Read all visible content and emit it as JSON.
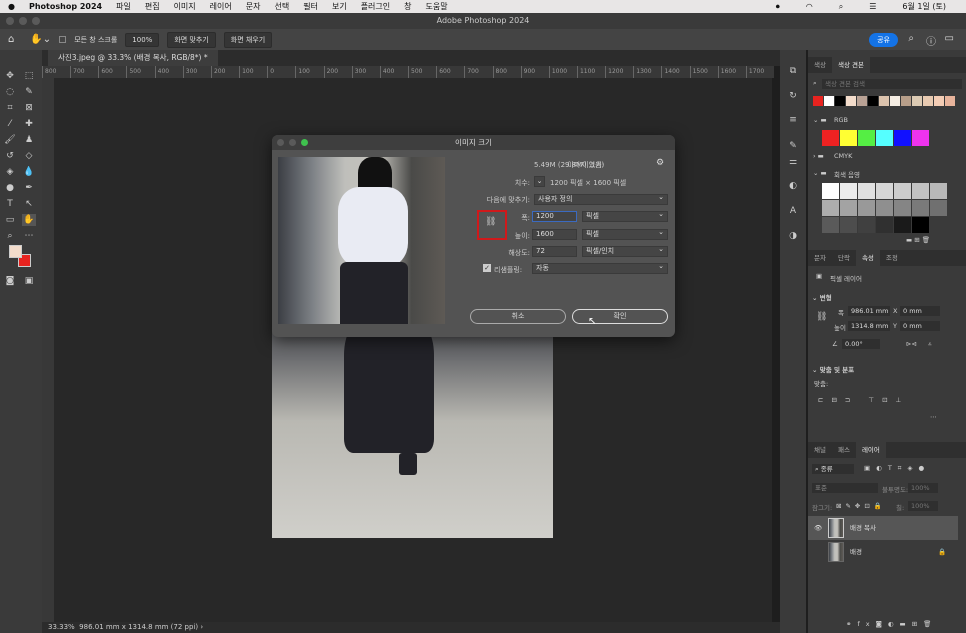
{
  "menubar": {
    "app": "Photoshop 2024",
    "items": [
      "파일",
      "편집",
      "이미지",
      "레이어",
      "문자",
      "선택",
      "필터",
      "보기",
      "플러그인",
      "창",
      "도움말"
    ],
    "date": "6월 1일 (토)"
  },
  "window": {
    "title": "Adobe Photoshop 2024"
  },
  "options": {
    "scroll_all": "모든 창 스크롤",
    "zoom": "100%",
    "fit_screen": "화면 맞추기",
    "fill_screen": "화면 채우기",
    "share": "공유"
  },
  "document": {
    "tab": "사진3.jpeg @ 33.3% (배경 복사, RGB/8*) *",
    "zoom": "33.33%",
    "info": "986.01 mm x 1314.8 mm (72 ppi)"
  },
  "ruler": [
    "800",
    "700",
    "600",
    "500",
    "400",
    "300",
    "200",
    "100",
    "0",
    "100",
    "200",
    "300",
    "400",
    "500",
    "600",
    "700",
    "800",
    "900",
    "1000",
    "1100",
    "1200",
    "1300",
    "1400",
    "1500",
    "1600",
    "1700"
  ],
  "dialog": {
    "title": "이미지 크기",
    "image_size_label": "이미지 크기:",
    "image_size": "5.49M (29.8M이었음)",
    "dimensions_label": "치수:",
    "dimensions": "1200 픽셀 × 1600 픽셀",
    "fit_label": "다음에 맞추기:",
    "fit": "사용자 정의",
    "width_label": "폭:",
    "width": "1200",
    "width_unit": "픽셀",
    "height_label": "높이:",
    "height": "1600",
    "height_unit": "픽셀",
    "resolution_label": "해상도:",
    "resolution": "72",
    "resolution_unit": "픽셀/인치",
    "resample_label": "리샘플링:",
    "resample": "자동",
    "resample_checked": true,
    "cancel": "취소",
    "ok": "확인",
    "highlight_color": "#d0191b"
  },
  "swatches_panel": {
    "tabs": [
      "색상",
      "색상 견본"
    ],
    "search_placeholder": "색상 견본 검색",
    "recent": [
      "#e8231f",
      "#ffffff",
      "#000000",
      "#f3dccb",
      "#b9a295",
      "#000000",
      "#dcc3ad",
      "#f5ede3",
      "#b89f8a",
      "#dccab3",
      "#e8cab1",
      "#f4cdb5",
      "#e8b49c"
    ],
    "groups": [
      {
        "name": "RGB",
        "colors": [
          "#ee2222",
          "#ffff33",
          "#55ee44",
          "#55ffff",
          "#1111ff",
          "#ee33ee"
        ]
      },
      {
        "name": "CMYK"
      },
      {
        "name": "회색 음영",
        "colors": [
          "#ffffff",
          "#ececec",
          "#e0e0e0",
          "#d6d6d6",
          "#cccccc",
          "#c2c2c2",
          "#b8b8b8",
          "#adadad",
          "#a3a3a3",
          "#999999",
          "#8f8f8f",
          "#858585",
          "#7a7a7a",
          "#707070",
          "#5a5a5a",
          "#4d4d4d",
          "#404040",
          "#303030",
          "#1a1a1a",
          "#000000"
        ]
      }
    ]
  },
  "properties_panel": {
    "tabs": [
      "문자",
      "단락",
      "속성",
      "조정"
    ],
    "type": "픽셀 레이어",
    "transform": "변형",
    "w_label": "폭",
    "w": "986.01 mm",
    "h_label": "높이",
    "h": "1314.8 mm",
    "x_label": "X",
    "x": "0 mm",
    "y_label": "Y",
    "y": "0 mm",
    "angle": "0.00°",
    "align": "맞춤 및 분포",
    "align_label": "맞춤:"
  },
  "layers_panel": {
    "tabs": [
      "채널",
      "패스",
      "레이어"
    ],
    "filter": "종류",
    "blend": "표준",
    "opacity_label": "불투명도:",
    "opacity": "100%",
    "lock_label": "잠그기:",
    "fill_label": "칠:",
    "fill": "100%",
    "layers": [
      {
        "name": "배경 복사",
        "visible": true,
        "selected": true
      },
      {
        "name": "배경",
        "locked": true
      }
    ]
  }
}
